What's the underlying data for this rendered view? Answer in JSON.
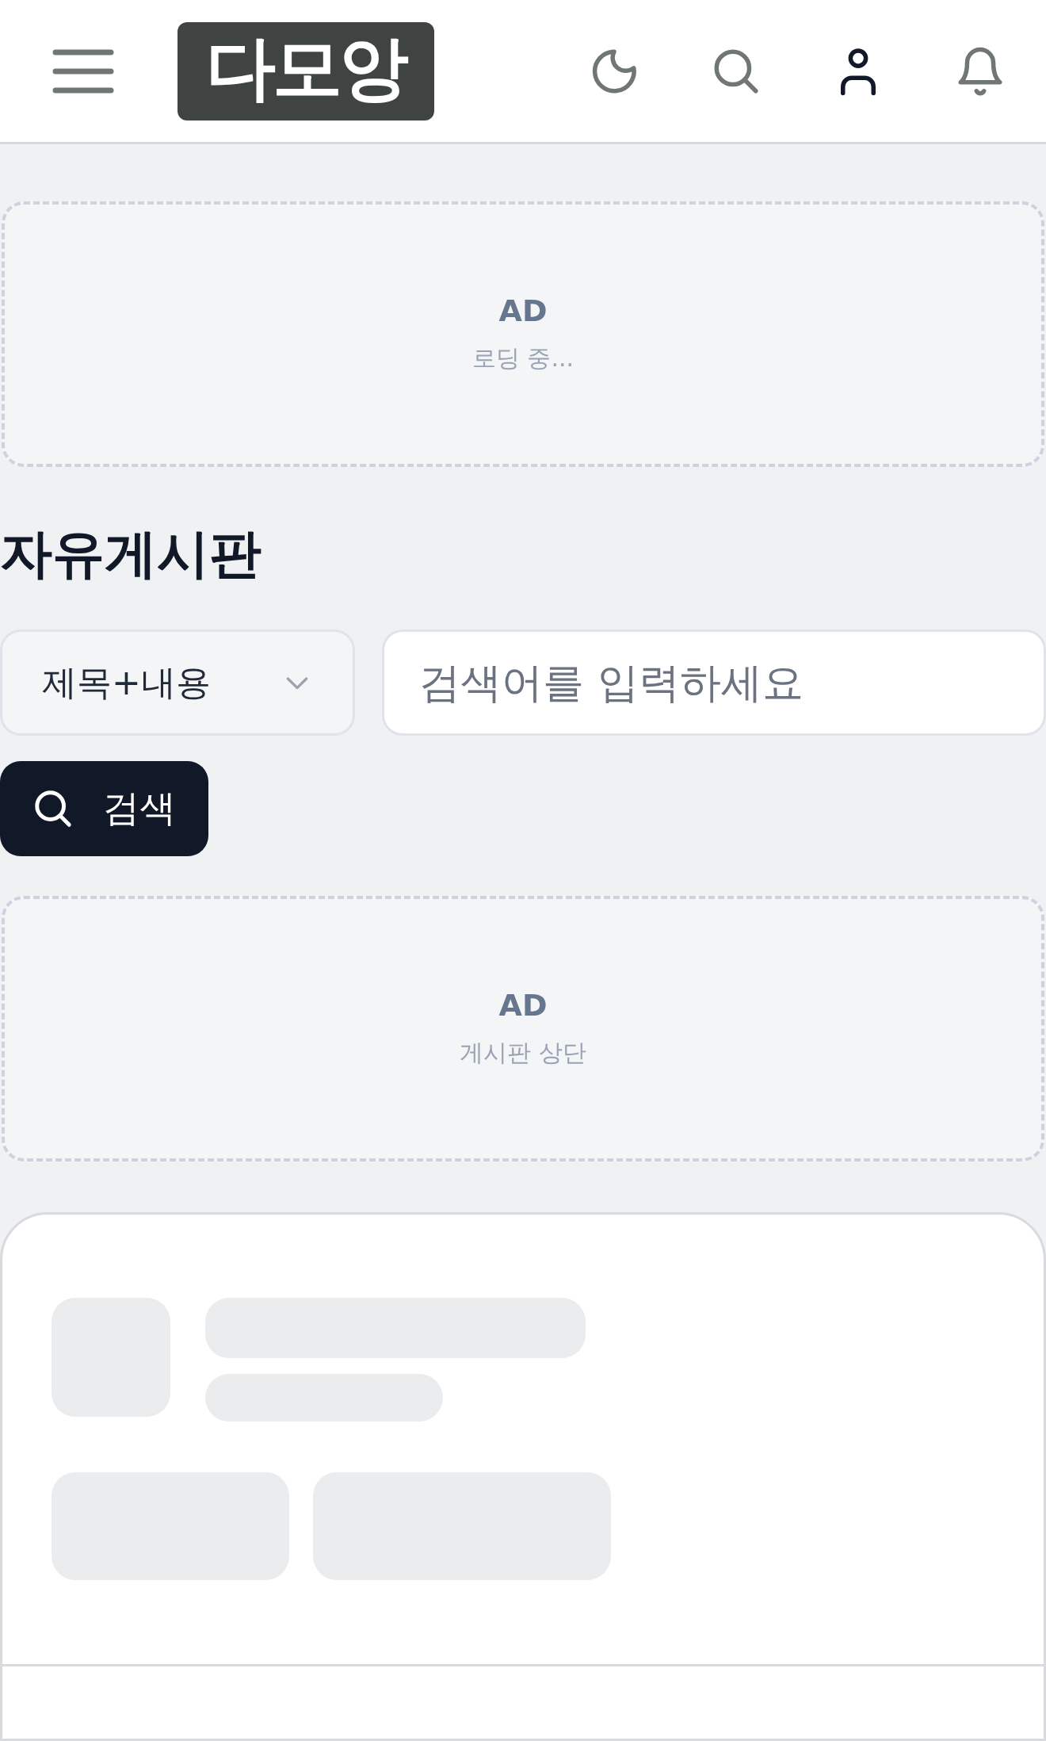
{
  "header": {
    "logo": "다모앙"
  },
  "ads": [
    {
      "label": "AD",
      "caption": "로딩 중..."
    },
    {
      "label": "AD",
      "caption": "게시판 상단"
    }
  ],
  "board": {
    "title": "자유게시판"
  },
  "search": {
    "scope": "제목+내용",
    "placeholder": "검색어를 입력하세요",
    "button": "검색"
  }
}
